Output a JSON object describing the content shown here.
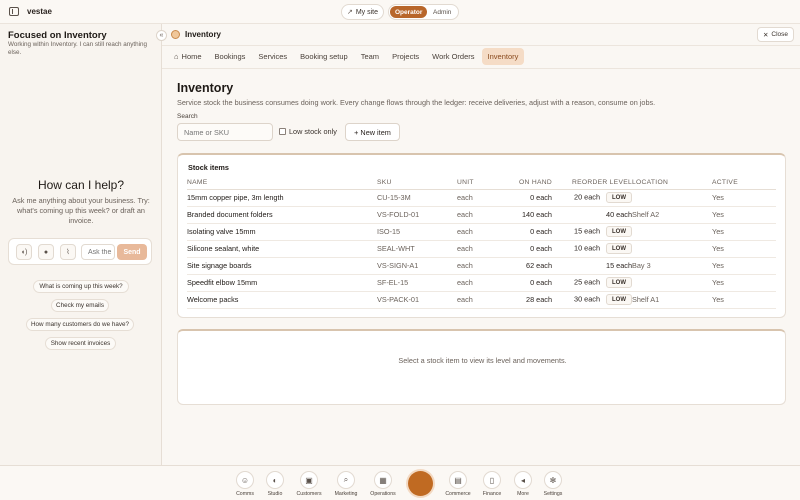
{
  "topbar": {
    "brand": "vestae",
    "my_site": "My site",
    "role_operator": "Operator",
    "role_admin": "Admin"
  },
  "left_panel": {
    "focus_title": "Focused on Inventory",
    "focus_desc": "Working within Inventory. I can still reach anything else.",
    "help_title": "How can I help?",
    "help_desc": "Ask me anything about your business. Try: what's coming up this week? or draft an invoice.",
    "ask_placeholder": "Ask the",
    "send_label": "Send",
    "suggestions": [
      "What is coming up this week?",
      "Check my emails",
      "How many customers do we have?",
      "Show recent invoices"
    ]
  },
  "main": {
    "tab_title": "Inventory",
    "close_label": "Close",
    "nav": [
      "Home",
      "Bookings",
      "Services",
      "Booking setup",
      "Team",
      "Projects",
      "Work Orders",
      "Inventory"
    ],
    "active_nav": "Inventory",
    "page_title": "Inventory",
    "page_desc": "Service stock the business consumes doing work. Every change flows through the ledger: receive deliveries, adjust with a reason, consume on jobs.",
    "search_label": "Search",
    "search_placeholder": "Name or SKU",
    "low_stock_label": "Low stock only",
    "new_item_label": "+ New item",
    "stock_card_title": "Stock items",
    "columns": [
      "NAME",
      "SKU",
      "UNIT",
      "ON HAND",
      "REORDER LEVEL",
      "LOCATION",
      "ACTIVE"
    ],
    "rows": [
      {
        "name": "15mm copper pipe, 3m length",
        "sku": "CU-15-3M",
        "unit": "each",
        "on_hand": "0 each",
        "reorder": "20 each",
        "low": "LOW",
        "location": "",
        "active": "Yes"
      },
      {
        "name": "Branded document folders",
        "sku": "VS-FOLD-01",
        "unit": "each",
        "on_hand": "140 each",
        "reorder": "40 each",
        "low": "",
        "location": "Shelf A2",
        "active": "Yes"
      },
      {
        "name": "Isolating valve 15mm",
        "sku": "ISO-15",
        "unit": "each",
        "on_hand": "0 each",
        "reorder": "15 each",
        "low": "LOW",
        "location": "",
        "active": "Yes"
      },
      {
        "name": "Silicone sealant, white",
        "sku": "SEAL-WHT",
        "unit": "each",
        "on_hand": "0 each",
        "reorder": "10 each",
        "low": "LOW",
        "location": "",
        "active": "Yes"
      },
      {
        "name": "Site signage boards",
        "sku": "VS-SIGN-A1",
        "unit": "each",
        "on_hand": "62 each",
        "reorder": "15 each",
        "low": "",
        "location": "Bay 3",
        "active": "Yes"
      },
      {
        "name": "Speedfit elbow 15mm",
        "sku": "SF-EL-15",
        "unit": "each",
        "on_hand": "0 each",
        "reorder": "25 each",
        "low": "LOW",
        "location": "",
        "active": "Yes"
      },
      {
        "name": "Welcome packs",
        "sku": "VS-PACK-01",
        "unit": "each",
        "on_hand": "28 each",
        "reorder": "30 each",
        "low": "LOW",
        "location": "Shelf A1",
        "active": "Yes"
      }
    ],
    "detail_message": "Select a stock item to view its level and movements."
  },
  "dock": {
    "items": [
      "Comms",
      "Studio",
      "Customers",
      "Marketing",
      "Operations",
      "Commerce",
      "Finance",
      "More",
      "Settings"
    ]
  },
  "colors": {
    "accent": "#b8662a",
    "active_tab_bg": "#f5dcc6",
    "send_button": "#e8b99a"
  }
}
